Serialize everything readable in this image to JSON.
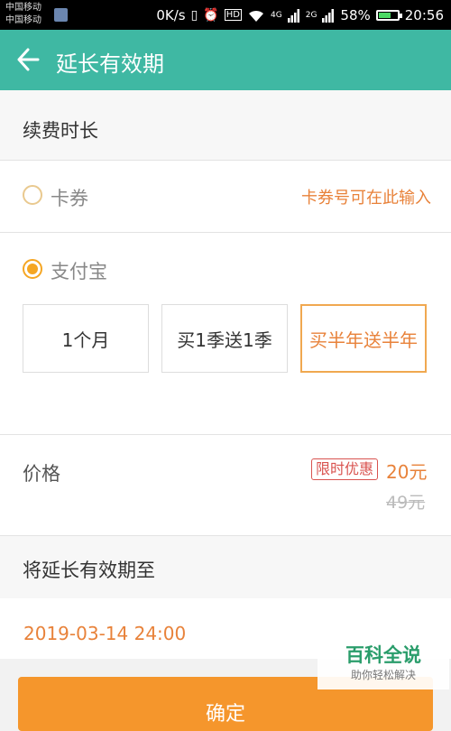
{
  "status_bar": {
    "carrier_1": "中国移动",
    "carrier_2": "中国移动",
    "speed": "0K/s",
    "hd": "HD",
    "net_4g": "4G",
    "net_2g": "2G",
    "battery": "58%",
    "battery_level": 0.58,
    "time": "20:56"
  },
  "header": {
    "title": "延长有效期"
  },
  "renewal": {
    "section_title": "续费时长",
    "card_option": {
      "label": "卡券",
      "hint": "卡券号可在此输入",
      "selected": false
    },
    "alipay_option": {
      "label": "支付宝",
      "selected": true
    },
    "plans": [
      {
        "label": "1个月",
        "selected": false
      },
      {
        "label": "买1季送1季",
        "selected": false
      },
      {
        "label": "买半年送半年",
        "selected": true
      }
    ]
  },
  "price": {
    "label": "价格",
    "badge": "限时优惠",
    "current": "20元",
    "original": "49元"
  },
  "extend": {
    "section_title": "将延长有效期至",
    "date": "2019-03-14 24:00"
  },
  "confirm_label": "确定",
  "watermark": {
    "main": "百科全说",
    "sub": "助你轻松解决"
  },
  "colors": {
    "header": "#3fb8a3",
    "accent": "#f5962c",
    "orange_text": "#e8823a",
    "badge_red": "#d9534f"
  }
}
